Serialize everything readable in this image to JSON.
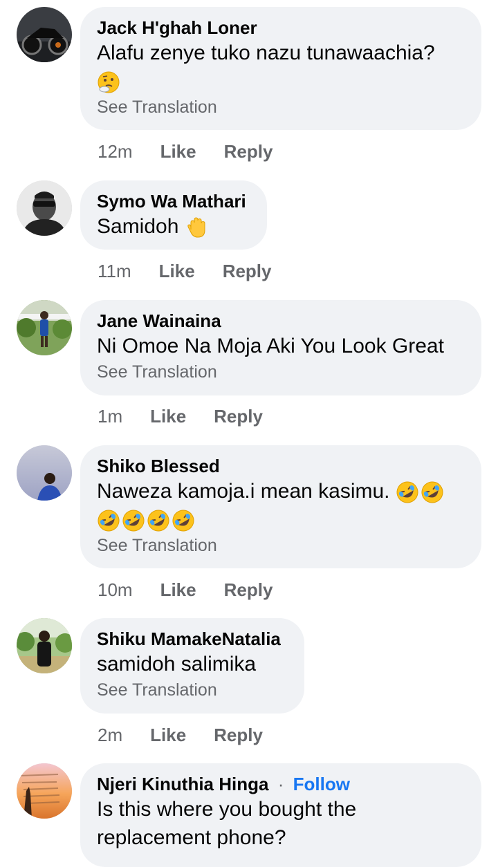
{
  "comments": [
    {
      "author": "Jack H'ghah Loner",
      "text": "Alafu zenye tuko nazu tunawaachia?",
      "emoji": "thinking-face",
      "see_translation": "See Translation",
      "time": "12m",
      "like": "Like",
      "reply": "Reply"
    },
    {
      "author": "Symo Wa Mathari",
      "text": "Samidoh",
      "emoji": "raised-hand",
      "time": "11m",
      "like": "Like",
      "reply": "Reply"
    },
    {
      "author": "Jane Wainaina",
      "text": "Ni Omoe Na Moja Aki You Look Great",
      "see_translation": "See Translation",
      "time": "1m",
      "like": "Like",
      "reply": "Reply"
    },
    {
      "author": "Shiko Blessed",
      "text": "Naweza kamoja.i mean kasimu.",
      "emoji": "rolling-on-floor-laughing",
      "see_translation": "See Translation",
      "time": "10m",
      "like": "Like",
      "reply": "Reply"
    },
    {
      "author": "Shiku MamakeNatalia",
      "text": "samidoh salimika",
      "see_translation": "See Translation",
      "time": "2m",
      "like": "Like",
      "reply": "Reply"
    },
    {
      "author": "Njeri Kinuthia Hinga",
      "follow": "Follow",
      "separator": "·",
      "text_line1": "Is this where you bought the",
      "text_line2": "replacement phone?"
    }
  ],
  "colors": {
    "bubble": "#f0f2f5",
    "secondary_text": "#65676b",
    "follow": "#1877f2"
  }
}
